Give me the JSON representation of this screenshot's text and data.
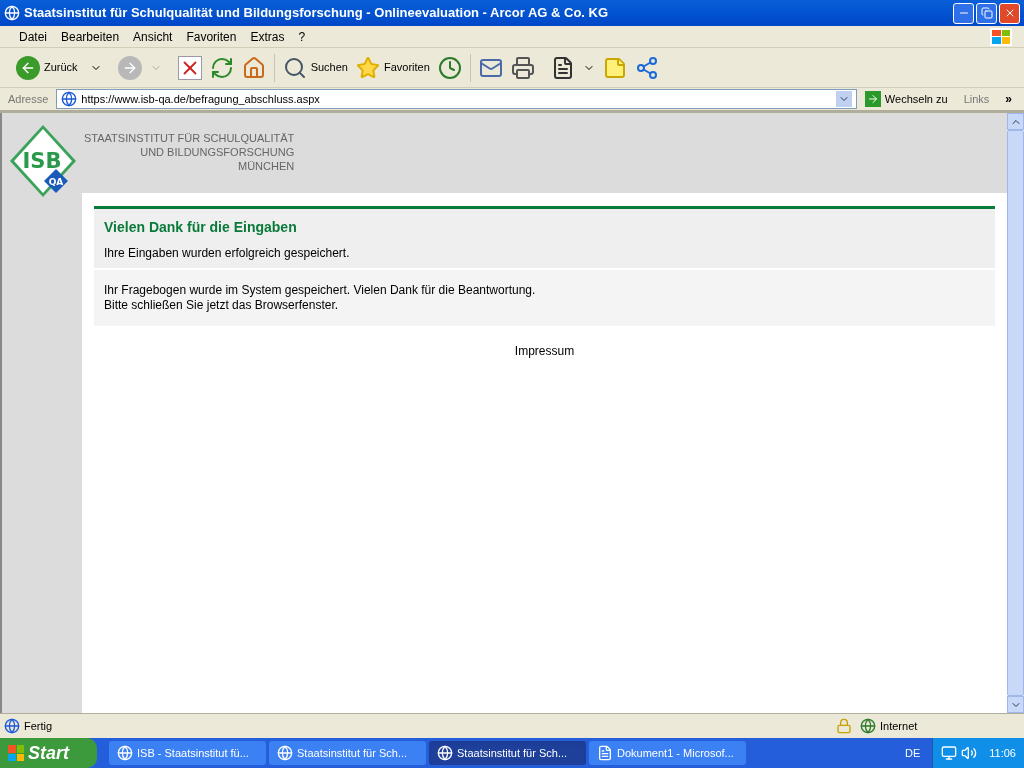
{
  "window": {
    "title": "Staatsinstitut für Schulqualität und Bildungsforschung - Onlineevaluation - Arcor AG & Co. KG"
  },
  "menu": [
    "Datei",
    "Bearbeiten",
    "Ansicht",
    "Favoriten",
    "Extras",
    "?"
  ],
  "toolbar": {
    "back_label": "Zurück",
    "search_label": "Suchen",
    "favorites_label": "Favoriten"
  },
  "address_bar": {
    "label": "Adresse",
    "url": "https://www.isb-qa.de/befragung_abschluss.aspx",
    "go_label": "Wechseln zu",
    "links_label": "Links",
    "more": "»"
  },
  "logo": {
    "mark": "ISB",
    "badge": "QA",
    "lines": [
      "STAATSINSTITUT FÜR SCHULQUALITÄT",
      "UND BILDUNGSFORSCHUNG",
      "MÜNCHEN"
    ]
  },
  "panel": {
    "heading": "Vielen Dank für die Eingaben",
    "subtext": "Ihre Eingaben wurden erfolgreich gespeichert.",
    "message": [
      "Ihr Fragebogen wurde im System gespeichert. Vielen Dank für die Beantwortung.",
      "Bitte schließen Sie jetzt das Browserfenster."
    ],
    "footer_link": "Impressum"
  },
  "status_bar": {
    "text": "Fertig",
    "zone": "Internet"
  },
  "taskbar": {
    "start": "Start",
    "tasks": [
      {
        "label": "ISB - Staatsinstitut fü...",
        "kind": "ie",
        "selected": false
      },
      {
        "label": "Staatsinstitut für Sch...",
        "kind": "ie",
        "selected": false
      },
      {
        "label": "Staatsinstitut für Sch...",
        "kind": "ie",
        "selected": true
      },
      {
        "label": "Dokument1 - Microsof...",
        "kind": "word",
        "selected": false
      }
    ],
    "language": "DE",
    "clock": "11:06"
  }
}
